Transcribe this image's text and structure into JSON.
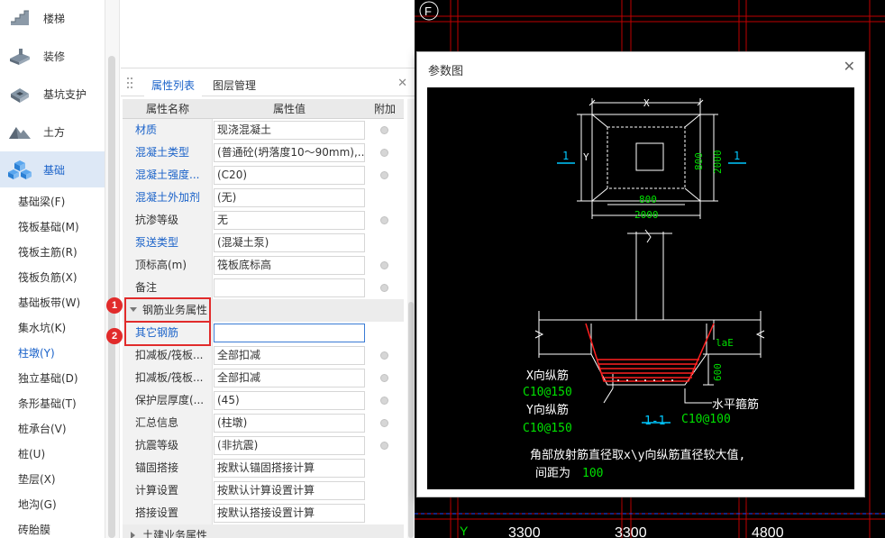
{
  "nav": {
    "categories": [
      {
        "label": "楼梯",
        "icon": "stair-icon"
      },
      {
        "label": "装修",
        "icon": "decoration-icon"
      },
      {
        "label": "基坑支护",
        "icon": "pit-support-icon"
      },
      {
        "label": "土方",
        "icon": "earthwork-icon"
      },
      {
        "label": "基础",
        "icon": "foundation-icon"
      }
    ],
    "sub_items": [
      "基础梁(F)",
      "筏板基础(M)",
      "筏板主筋(R)",
      "筏板负筋(X)",
      "基础板带(W)",
      "集水坑(K)",
      "柱墩(Y)",
      "独立基础(D)",
      "条形基础(T)",
      "桩承台(V)",
      "桩(U)",
      "垫层(X)",
      "地沟(G)",
      "砖胎膜"
    ]
  },
  "panel": {
    "tabs": [
      "属性列表",
      "图层管理"
    ],
    "columns": [
      "属性名称",
      "属性值",
      "附加"
    ],
    "rows": [
      {
        "name": "材质",
        "value": "现浇混凝土"
      },
      {
        "name": "混凝土类型",
        "value": "(普通砼(坍落度10～90mm),..."
      },
      {
        "name": "混凝土强度...",
        "value": "(C20)"
      },
      {
        "name": "混凝土外加剂",
        "value": "(无)"
      },
      {
        "name": "抗渗等级",
        "value": "无"
      },
      {
        "name": "泵送类型",
        "value": "(混凝土泵)"
      },
      {
        "name": "顶标高(m)",
        "value": "筏板底标高"
      },
      {
        "name": "备注",
        "value": ""
      }
    ],
    "group1": "钢筋业务属性",
    "rebar_rows": [
      {
        "name": "其它钢筋",
        "value": ""
      },
      {
        "name": "扣减板/筏板...",
        "value": "全部扣减"
      },
      {
        "name": "扣减板/筏板...",
        "value": "全部扣减"
      },
      {
        "name": "保护层厚度(...",
        "value": "(45)"
      },
      {
        "name": "汇总信息",
        "value": "(柱墩)"
      },
      {
        "name": "抗震等级",
        "value": "(非抗震)"
      },
      {
        "name": "锚固搭接",
        "value": "按默认锚固搭接计算"
      },
      {
        "name": "计算设置",
        "value": "按默认计算设置计算"
      },
      {
        "name": "搭接设置",
        "value": "按默认搭接设置计算"
      }
    ],
    "group2": "土建业务属性",
    "badges": [
      "1",
      "2"
    ]
  },
  "cad": {
    "axis_f": "F",
    "axis_y": "Y",
    "dims": [
      "3300",
      "3300",
      "4800"
    ]
  },
  "dialog": {
    "title": "参数图",
    "drawing": {
      "dim_x": "X",
      "dim_y": "Y",
      "dim_800_v": "800",
      "dim_2000_v": "2000",
      "dim_800_h": "800",
      "dim_2000_h": "2000",
      "sec_mark_left": "1",
      "sec_mark_right": "1",
      "lae": "laE",
      "dim_600": "600",
      "x_rebar": "X向纵筋",
      "x_rebar_spec": "C10@150",
      "y_rebar": "Y向纵筋",
      "y_rebar_spec": "C10@150",
      "section_label": "1-1",
      "stirrup": "水平箍筋",
      "stirrup_spec": "C10@100",
      "note_line1": "角部放射筋直径取x\\y向纵筋直径较大值,",
      "note_line2_prefix": "间距为",
      "note_line2_value": "100"
    }
  },
  "colors": {
    "accent": "#1a62c9",
    "highlight_red": "#e12b2b",
    "cad_bg": "#000000",
    "cad_white": "#ffffff",
    "cad_green": "#00e000",
    "cad_cyan": "#00c8ff",
    "cad_red": "#ff2020"
  }
}
